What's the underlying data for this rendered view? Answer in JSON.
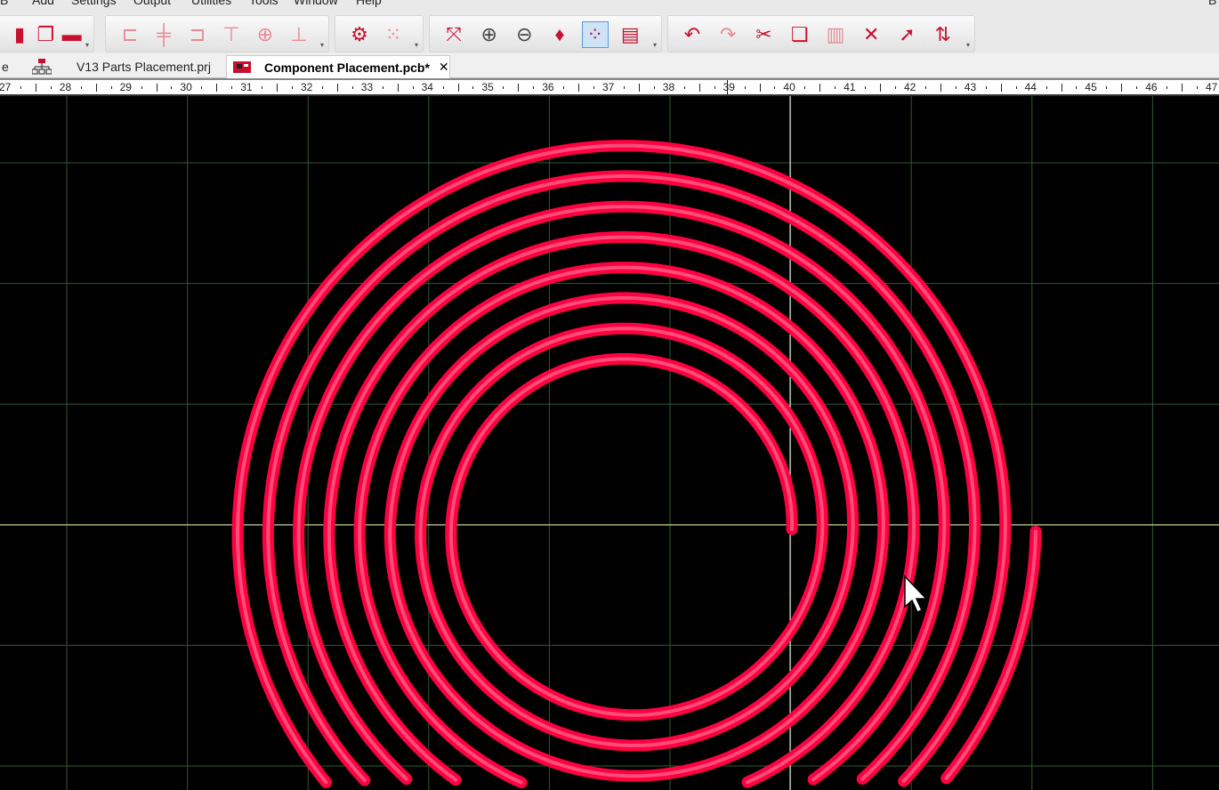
{
  "menu": [
    "B",
    "Add",
    "Settings",
    "Output",
    "Utilities",
    "Tools",
    "Window",
    "Help",
    "B"
  ],
  "toolbar": {
    "groups": [
      {
        "icons": [
          "new-file-icon",
          "check-layers-icon",
          "open-folder-icon"
        ]
      },
      {
        "icons": [
          "align-left-icon",
          "align-center-icon",
          "align-right-icon",
          "align-top-icon",
          "align-middle-icon",
          "align-bottom-icon"
        ]
      },
      {
        "icons": [
          "settings-gears-icon",
          "grid-edit-icon"
        ]
      },
      {
        "icons": [
          "zoom-fit-icon",
          "zoom-in-icon",
          "zoom-out-icon",
          "paint-bucket-icon",
          "grid-toggle-icon",
          "properties-icon"
        ]
      },
      {
        "icons": [
          "undo-icon",
          "redo-icon",
          "cut-icon",
          "copy-icon",
          "paste-icon",
          "delete-icon",
          "select-pointer-icon",
          "swap-component-icon"
        ]
      }
    ]
  },
  "tabs": [
    {
      "label": "e",
      "active": false
    },
    {
      "label": "V13 Parts Placement.prj",
      "active": false
    },
    {
      "label": "Component Placement.pcb*",
      "active": true,
      "close": "✕"
    }
  ],
  "ruler": {
    "start": 27,
    "end": 47,
    "cursor_label": "39"
  },
  "colors": {
    "trace": "#ff0040",
    "trace_core": "#ff4d7a",
    "grid": "#2f5a2f",
    "crosshair_v": "#ffffff",
    "crosshair_h": "#f5f0b0"
  }
}
